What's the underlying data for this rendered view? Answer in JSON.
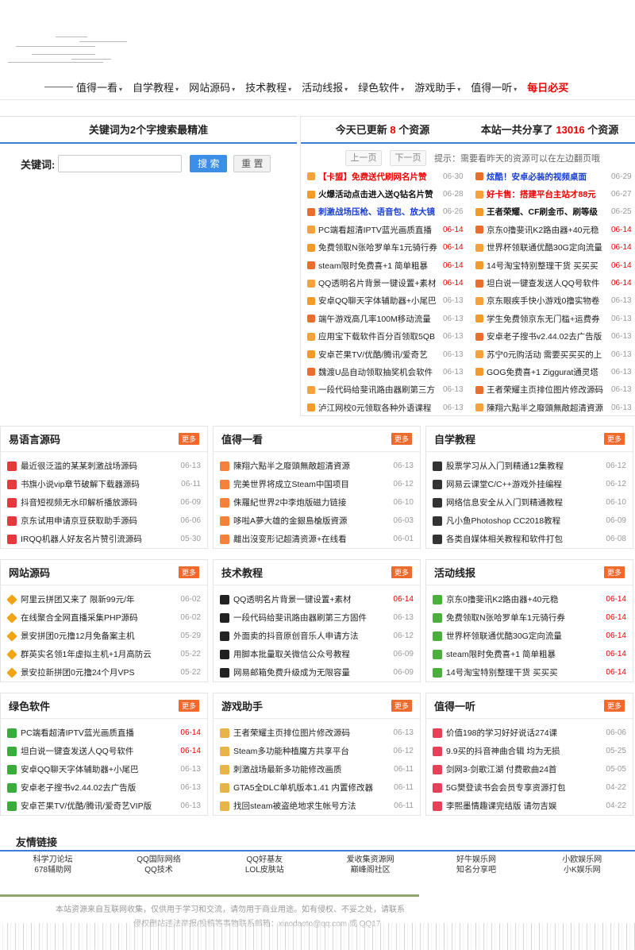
{
  "nav": {
    "items": [
      {
        "label": "值得一看",
        "caret": "▾"
      },
      {
        "label": "自学教程",
        "caret": "▾"
      },
      {
        "label": "网站源码",
        "caret": "▾"
      },
      {
        "label": "技术教程",
        "caret": "▾"
      },
      {
        "label": "活动线报",
        "caret": "▾"
      },
      {
        "label": "绿色软件",
        "caret": "▾"
      },
      {
        "label": "游戏助手",
        "caret": "▾"
      },
      {
        "label": "值得一听",
        "caret": "▾"
      }
    ],
    "hot": "每日必买"
  },
  "search": {
    "title": "关键词为2个字搜索最精准",
    "label": "关键词:",
    "search_btn": "搜 索",
    "reset_btn": "重 置"
  },
  "resources": {
    "today_prefix": "今天已更新",
    "today_count": "8",
    "today_suffix": "个资源",
    "total_prefix": "本站一共分享了",
    "total_count": "13016",
    "total_suffix": "个资源",
    "prev": "上一页",
    "next": "下一页",
    "tip": "提示：需要看昨天的资源可以在左边翻页哦",
    "items": [
      {
        "title": "【卡盟】免费送代刷网名片赞",
        "date": "06-30",
        "style": "red"
      },
      {
        "title": "炫酷！安卓必装的视频桌面",
        "date": "06-29",
        "style": "blue"
      },
      {
        "title": "火爆活动点击进入送Q钻名片赞",
        "date": "06-28",
        "style": "blk"
      },
      {
        "title": "好卡售：搭建平台主站才88元",
        "date": "06-27",
        "style": "red"
      },
      {
        "title": "刺激战场压枪、语音包、放大镜",
        "date": "06-26",
        "style": "blue"
      },
      {
        "title": "王者荣耀、CF刷金币、刷等级",
        "date": "06-25",
        "style": "blk"
      },
      {
        "title": "PC端看超清IPTV蓝光画质直播",
        "date": "06-14",
        "style": "",
        "hot": true
      },
      {
        "title": "京东0撸斐讯K2路由器+40元稳",
        "date": "06-14",
        "style": "",
        "hot": true
      },
      {
        "title": "免费领取N张哈罗单车1元骑行券",
        "date": "06-14",
        "style": "",
        "hot": true
      },
      {
        "title": "世界杯领联通优酷30G定向流量",
        "date": "06-14",
        "style": "",
        "hot": true
      },
      {
        "title": "steam限时免费喜+1 简单粗暴",
        "date": "06-14",
        "style": "",
        "hot": true
      },
      {
        "title": "14号淘宝特别整理干货 买买买",
        "date": "06-14",
        "style": "",
        "hot": true
      },
      {
        "title": "QQ透明名片背景一键设置+素材",
        "date": "06-14",
        "style": "",
        "hot": true
      },
      {
        "title": "坦白说一键查发送人QQ号软件",
        "date": "06-14",
        "style": "",
        "hot": true
      },
      {
        "title": "安卓QQ聊天字体辅助器+小尾巴",
        "date": "06-13",
        "style": ""
      },
      {
        "title": "京东眼疾手快小游戏0撸实物卷",
        "date": "06-13",
        "style": ""
      },
      {
        "title": "端午游戏高几率100M移动流量",
        "date": "06-13",
        "style": ""
      },
      {
        "title": "学生免费领京东无门槛+运费券",
        "date": "06-13",
        "style": ""
      },
      {
        "title": "应用宝下载软件百分百领取5QB",
        "date": "06-13",
        "style": ""
      },
      {
        "title": "安卓老子搜书v2.44.02去广告版",
        "date": "06-13",
        "style": ""
      },
      {
        "title": "安卓芒果TV/优酷/腾讯/爱奇艺",
        "date": "06-13",
        "style": ""
      },
      {
        "title": "苏宁0元购活动 需要买买买的上",
        "date": "06-13",
        "style": ""
      },
      {
        "title": "魏渡U品自动领取抽奖机会软件",
        "date": "06-13",
        "style": ""
      },
      {
        "title": "GOG免费喜+1 Ziggurat通灵塔",
        "date": "06-13",
        "style": ""
      },
      {
        "title": "一段代码给斐讯路由器刷第三方",
        "date": "06-13",
        "style": ""
      },
      {
        "title": "王者荣耀主页排位图片修改源码",
        "date": "06-13",
        "style": ""
      },
      {
        "title": "泸江网校0元领取各种外语课程",
        "date": "06-13",
        "style": ""
      },
      {
        "title": "陳翔六點半之廢頭無敵超清資源",
        "date": "06-13",
        "style": ""
      }
    ]
  },
  "more_label": "更多",
  "boxes": [
    {
      "title": "易语言源码",
      "icon": "e-icon",
      "items": [
        {
          "t": "最近很泛滥的某某刺激战场源码",
          "d": "06-13"
        },
        {
          "t": "书旗小说vip章节破解下载器源码",
          "d": "06-11"
        },
        {
          "t": "抖音短视频无水印解析播放源码",
          "d": "06-09"
        },
        {
          "t": "京东试用申请京豆获取助手源码",
          "d": "06-06"
        },
        {
          "t": "IRQQ机器人好友名片赞引流源码",
          "d": "05-30"
        }
      ]
    },
    {
      "title": "值得一看",
      "icon": "bulb-icon",
      "items": [
        {
          "t": "陳翔六點半之廢頭無敵超清資源",
          "d": "06-13"
        },
        {
          "t": "完美世界将成立Steam中国项目",
          "d": "06-12"
        },
        {
          "t": "侏羅紀世界2中李炮版磁力链接",
          "d": "06-10"
        },
        {
          "t": "哆啦A夢大雄的金銀島槍版資源",
          "d": "06-03"
        },
        {
          "t": "離出沒变形记超清资源+在线看",
          "d": "06-01"
        }
      ]
    },
    {
      "title": "自学教程",
      "icon": "clapper-icon",
      "items": [
        {
          "t": "股票学习从入门到精通12集教程",
          "d": "06-12"
        },
        {
          "t": "网易云课堂C/C++游戏外挂编程",
          "d": "06-12"
        },
        {
          "t": "网络信息安全从入门到精通教程",
          "d": "06-10"
        },
        {
          "t": "凡小鱼Photoshop CC2018教程",
          "d": "06-09"
        },
        {
          "t": "各类自媒体相关教程和软件打包",
          "d": "06-08"
        }
      ]
    },
    {
      "title": "网站源码",
      "icon": "gem-icon",
      "items": [
        {
          "t": "阿里云拼团又来了 限新99元/年",
          "d": "06-02"
        },
        {
          "t": "在线聚合全网直播采集PHP源码",
          "d": "06-02"
        },
        {
          "t": "景安拼团0元撸12月免备案主机",
          "d": "05-29"
        },
        {
          "t": "群英实名领1年虚拟主机+1月高防云",
          "d": "05-22"
        },
        {
          "t": "景安拉新拼团0元撸24个月VPS",
          "d": "05-22"
        }
      ]
    },
    {
      "title": "技术教程",
      "icon": "qq-icon",
      "items": [
        {
          "t": "QQ透明名片背景一键设置+素材",
          "d": "06-14",
          "hot": true
        },
        {
          "t": "一段代码给斐讯路由器刷第三方固件",
          "d": "06-13"
        },
        {
          "t": "外面卖的抖音原创音乐人申请方法",
          "d": "06-12"
        },
        {
          "t": "用脚本批量取关微信公众号教程",
          "d": "06-09"
        },
        {
          "t": "网易邮箱免费升级成为无限容量",
          "d": "06-09"
        }
      ]
    },
    {
      "title": "活动线报",
      "icon": "check-circle-icon",
      "items": [
        {
          "t": "京东0撸斐讯K2路由器+40元稳",
          "d": "06-14",
          "hot": true
        },
        {
          "t": "免费领取N张哈罗单车1元骑行券",
          "d": "06-14",
          "hot": true
        },
        {
          "t": "世界杯领联通优酷30G定向流量",
          "d": "06-14",
          "hot": true
        },
        {
          "t": "steam限时免费喜+1 简单粗暴",
          "d": "06-14",
          "hot": true
        },
        {
          "t": "14号淘宝特别整理干货 买买买",
          "d": "06-14",
          "hot": true
        }
      ]
    },
    {
      "title": "绿色软件",
      "icon": "checkbox-icon",
      "items": [
        {
          "t": "PC端看超清IPTV蓝光画质直播",
          "d": "06-14",
          "hot": true
        },
        {
          "t": "坦白说一键查发送人QQ号软件",
          "d": "06-14",
          "hot": true
        },
        {
          "t": "安卓QQ聊天字体辅助器+小尾巴",
          "d": "06-13"
        },
        {
          "t": "安卓老子搜书v2.44.02去广告版",
          "d": "06-13"
        },
        {
          "t": "安卓芒果TV/优酷/腾讯/爱奇艺VIP版",
          "d": "06-13"
        }
      ]
    },
    {
      "title": "游戏助手",
      "icon": "thumb-icon",
      "items": [
        {
          "t": "王者荣耀主页排位图片修改源码",
          "d": "06-13"
        },
        {
          "t": "Steam多功能种植魔方共享平台",
          "d": "06-12"
        },
        {
          "t": "刺激战场最新多功能修改画质",
          "d": "06-11"
        },
        {
          "t": "GTA5全DLC单机版本1.41 内置修改器",
          "d": "06-11"
        },
        {
          "t": "找回steam被盗绝地求生帐号方法",
          "d": "06-11"
        }
      ]
    },
    {
      "title": "值得一听",
      "icon": "music-note-icon",
      "items": [
        {
          "t": "价值198的学习好好说话274课",
          "d": "06-06"
        },
        {
          "t": "9.9买的抖音神曲合辑 均为无损",
          "d": "05-25"
        },
        {
          "t": "剑网3-剑歌江湖 付费歌曲24首",
          "d": "05-05"
        },
        {
          "t": "5G樊登读书会会员专享资源打包",
          "d": "04-22"
        },
        {
          "t": "李熙墨情趣课完结版 请勿吉娱",
          "d": "04-22"
        }
      ]
    }
  ],
  "links": {
    "title": "友情链接",
    "items": [
      "科学刀论坛",
      "QQ国际网络",
      "QQ好基友",
      "爱收集资源网",
      "好牛娱乐网",
      "小欧娱乐网",
      "678辅助网",
      "QQ技术",
      "LOL皮肤站",
      "巅峰阁社区",
      "知名分享吧",
      "小K娱乐网"
    ]
  },
  "footer": {
    "line1": "本站资源来自互联网收集，仅供用于学习和交流，请勿用于商业用途。如有侵权、不妥之处，请联系",
    "line2": "侵权删站违法举报/投稿等事物联系邮箱：xiaodaoto@qq.com 或 QQ17"
  }
}
